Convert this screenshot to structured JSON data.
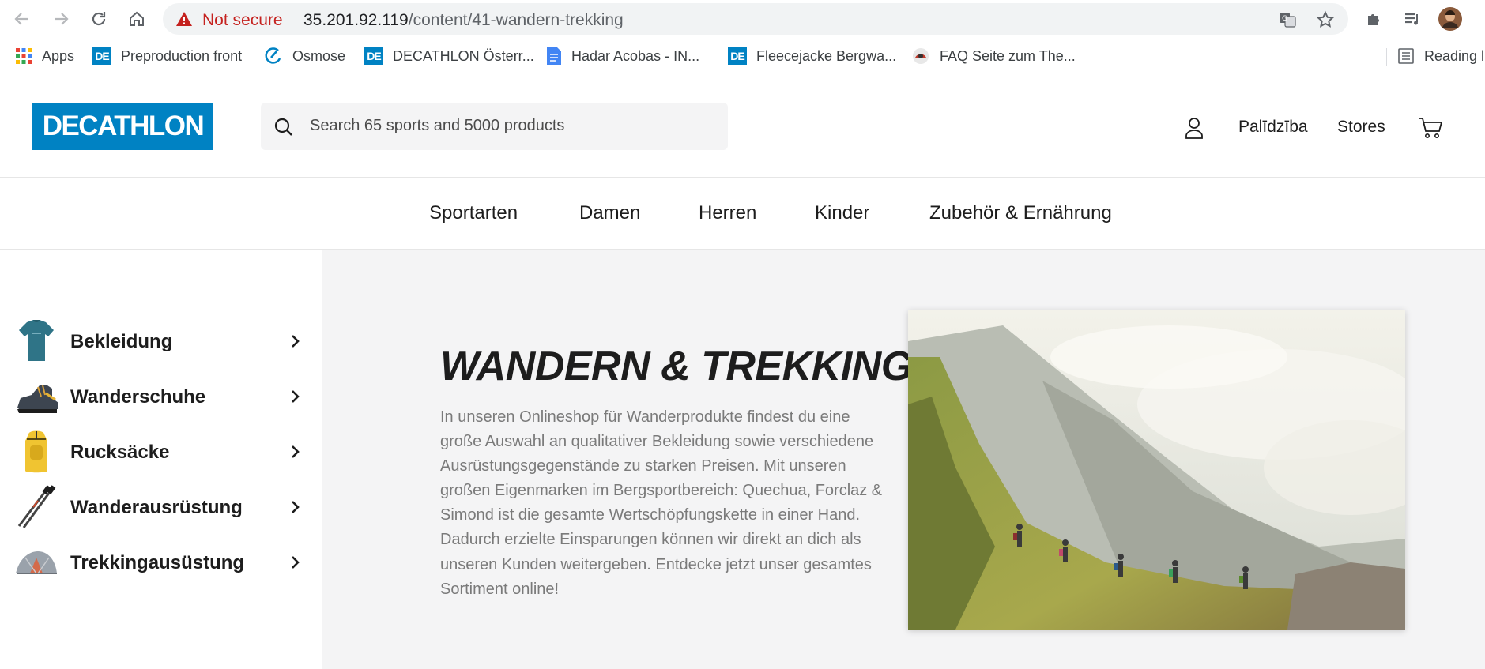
{
  "browser": {
    "not_secure": "Not secure",
    "url_host": "35.201.92.119",
    "url_path": "/content/41-wandern-trekking",
    "bookmarks": [
      {
        "label": "Apps",
        "icon": "apps-grid-icon"
      },
      {
        "label": "Preproduction front",
        "icon": "decathlon-favicon"
      },
      {
        "label": "Osmose",
        "icon": "osmose-favicon"
      },
      {
        "label": "DECATHLON Österr...",
        "icon": "decathlon-favicon"
      },
      {
        "label": "Hadar Acobas - IN...",
        "icon": "google-docs-icon"
      },
      {
        "label": "Fleecejacke Bergwa...",
        "icon": "decathlon-favicon"
      },
      {
        "label": "FAQ Seite zum The...",
        "icon": "faq-favicon"
      }
    ],
    "reading_list": "Reading li"
  },
  "header": {
    "logo": "DECATHLON",
    "search_placeholder": "Search 65 sports and 5000 products",
    "help": "Palīdzība",
    "stores": "Stores"
  },
  "nav": {
    "categories": [
      "Sportarten",
      "Damen",
      "Herren",
      "Kinder",
      "Zubehör & Ernährung"
    ]
  },
  "sidebar": {
    "items": [
      {
        "label": "Bekleidung",
        "icon": "tshirt-icon"
      },
      {
        "label": "Wanderschuhe",
        "icon": "hiking-boot-icon"
      },
      {
        "label": "Rucksäcke",
        "icon": "backpack-icon"
      },
      {
        "label": "Wanderausrüstung",
        "icon": "trekking-poles-icon"
      },
      {
        "label": "Trekkingausüstung",
        "icon": "tent-icon"
      }
    ]
  },
  "main": {
    "title": "WANDERN & TREKKING",
    "description": "In unseren Onlineshop für Wanderprodukte findest du eine große Auswahl an qualitativer Bekleidung sowie verschiedene Ausrüstungsgegenstände zu starken Preisen. Mit unseren großen Eigenmarken im Bergsportbereich: Quechua, Forclaz & Simond ist die gesamte Wertschöpfungskette in einer Hand. Dadurch erzielte Einsparungen können wir direkt an dich als unseren Kunden weitergeben. Entdecke jetzt unser gesamtes Sortiment online!"
  },
  "colors": {
    "brand_blue": "#0082c3",
    "main_bg": "#f4f4f5",
    "warning_red": "#c5221f"
  }
}
